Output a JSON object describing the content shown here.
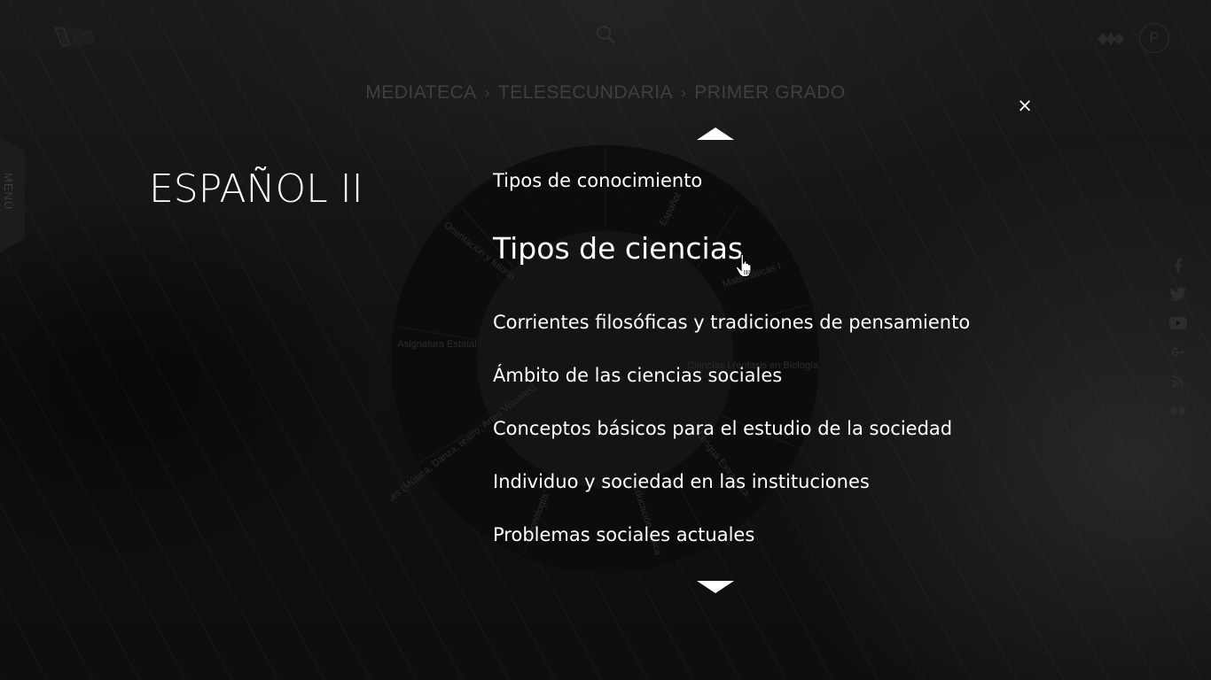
{
  "header": {
    "logo": {
      "line1": "Ventana",
      "line2": "Educativa"
    },
    "search_icon": "search-icon",
    "brand_icon": "diamonds-icon",
    "profile_label": "P"
  },
  "breadcrumb": [
    "MEDIATECA",
    "TELESECUNDARIA",
    "PRIMER GRADO"
  ],
  "menu_label": "MENÚ",
  "close_label": "×",
  "subject_title": "ESPAÑOL II",
  "wheel_labels": [
    "Ciencias I (énfasis en Biología)",
    "Matemáticas I",
    "Español",
    "Orientación y tutoría",
    "Asignatura Estatal",
    "Artes (Música, Danza, teatro, Artes Visuales)",
    "Tecnología",
    "Educación Física",
    "Lengua Extranjera"
  ],
  "topics": [
    "Tipos de conocimiento",
    "Tipos de ciencias",
    "Corrientes filosóficas y tradiciones de pensamiento",
    "Ámbito de las ciencias sociales",
    "Conceptos básicos para el estudio de la sociedad",
    "Individuo y sociedad en las instituciones",
    "Problemas sociales actuales"
  ],
  "active_topic_index": 1,
  "social": [
    "facebook-icon",
    "twitter-icon",
    "youtube-icon",
    "google-plus-icon",
    "rss-icon",
    "flickr-icon"
  ],
  "colors": {
    "background": "#121212",
    "text": "#ffffff",
    "muted": "#3f3f3f",
    "wheel": "#0d0d0d"
  }
}
